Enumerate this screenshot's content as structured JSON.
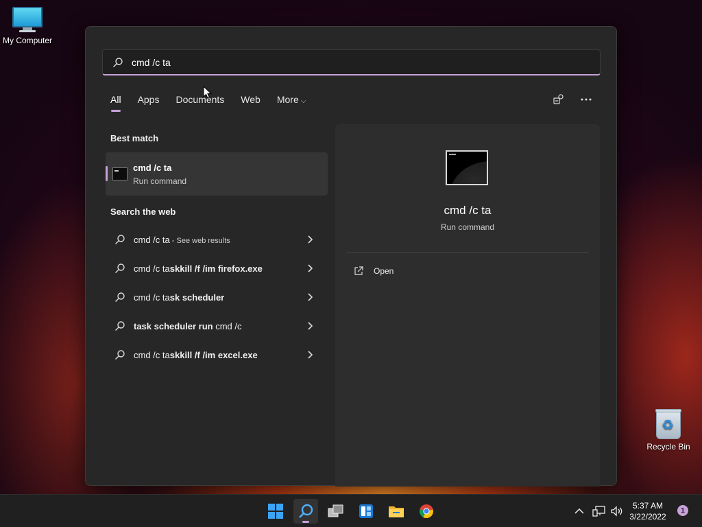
{
  "desktop": {
    "icons": [
      {
        "label": "My Computer",
        "icon": "monitor-icon"
      },
      {
        "label": "Recycle Bin",
        "icon": "recycle-bin-icon"
      }
    ]
  },
  "search": {
    "query": "cmd /c ta",
    "placeholder": ""
  },
  "tabs": [
    {
      "label": "All",
      "active": true
    },
    {
      "label": "Apps"
    },
    {
      "label": "Documents"
    },
    {
      "label": "Web"
    },
    {
      "label": "More"
    }
  ],
  "tools": {
    "share_icon": "people-search-icon",
    "more_icon": "ellipsis-icon"
  },
  "best_match": {
    "heading": "Best match",
    "title": "cmd /c ta",
    "subtitle": "Run command",
    "icon": "command-prompt-icon"
  },
  "web": {
    "heading": "Search the web",
    "items": [
      {
        "prefix": "cmd /c ta",
        "bold": "",
        "suffix": " - See web results"
      },
      {
        "prefix": "cmd /c ta",
        "bold": "skkill /f /im firefox.exe",
        "suffix": ""
      },
      {
        "prefix": "cmd /c ta",
        "bold": "sk scheduler",
        "suffix": ""
      },
      {
        "prefix": "",
        "bold": "task scheduler run",
        "suffix": " cmd /c"
      },
      {
        "prefix": "cmd /c ta",
        "bold": "skkill /f /im excel.exe",
        "suffix": ""
      }
    ]
  },
  "preview": {
    "title": "cmd /c ta",
    "subtitle": "Run command",
    "action": "Open"
  },
  "taskbar": {
    "apps": [
      "windows-start-icon",
      "search-icon",
      "task-view-icon",
      "widgets-icon",
      "file-explorer-icon",
      "chrome-icon"
    ],
    "time": "5:37 AM",
    "date": "3/22/2022",
    "notification_count": "1"
  },
  "colors": {
    "accent": "#c7a1d8",
    "panel": "#272727",
    "pane": "#2d2d2d"
  }
}
